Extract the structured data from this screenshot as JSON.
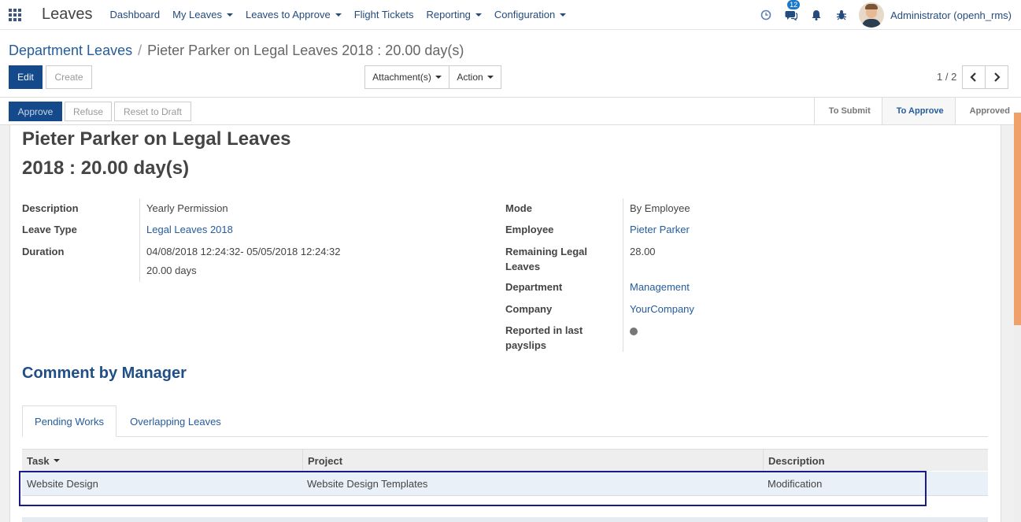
{
  "navbar": {
    "brand": "Leaves",
    "menu": [
      {
        "label": "Dashboard",
        "dropdown": false
      },
      {
        "label": "My Leaves",
        "dropdown": true
      },
      {
        "label": "Leaves to Approve",
        "dropdown": true
      },
      {
        "label": "Flight Tickets",
        "dropdown": false
      },
      {
        "label": "Reporting",
        "dropdown": true
      },
      {
        "label": "Configuration",
        "dropdown": true
      }
    ],
    "messages_badge": "12",
    "user": "Administrator (openh_rms)"
  },
  "breadcrumb": {
    "parent": "Department Leaves",
    "separator": "/",
    "current": "Pieter Parker on Legal Leaves 2018 : 20.00 day(s)"
  },
  "toolbar": {
    "edit": "Edit",
    "create": "Create",
    "attachments": "Attachment(s)",
    "action": "Action",
    "pager": "1 / 2"
  },
  "statusbar": {
    "approve": "Approve",
    "refuse": "Refuse",
    "reset": "Reset to Draft",
    "stages": [
      "To Submit",
      "To Approve",
      "Approved"
    ],
    "active_stage": "To Approve"
  },
  "record": {
    "title_line1": "Pieter Parker on Legal Leaves",
    "title_line2": "2018 : 20.00 day(s)"
  },
  "left_fields": {
    "description_label": "Description",
    "description_value": "Yearly Permission",
    "leave_type_label": "Leave Type",
    "leave_type_value": "Legal Leaves 2018",
    "duration_label": "Duration",
    "duration_dates": "04/08/2018 12:24:32- 05/05/2018 12:24:32",
    "duration_days": "20.00 days"
  },
  "right_fields": {
    "mode_label": "Mode",
    "mode_value": "By Employee",
    "employee_label": "Employee",
    "employee_value": "Pieter Parker",
    "remaining_label_1": "Remaining Legal",
    "remaining_label_2": "Leaves",
    "remaining_value": "28.00",
    "department_label": "Department",
    "department_value": "Management",
    "company_label": "Company",
    "company_value": "YourCompany",
    "reported_label_1": "Reported in last",
    "reported_label_2": "payslips"
  },
  "section": {
    "comment_title": "Comment by Manager"
  },
  "tabs": [
    "Pending Works",
    "Overlapping Leaves"
  ],
  "table": {
    "headers": [
      "Task",
      "Project",
      "Description"
    ],
    "rows": [
      [
        "Website Design",
        "Website Design Templates",
        "Modification"
      ]
    ]
  },
  "colors": {
    "primary": "#144a8c",
    "link": "#245c9c",
    "accent_scrollbar": "#f0a06b"
  }
}
